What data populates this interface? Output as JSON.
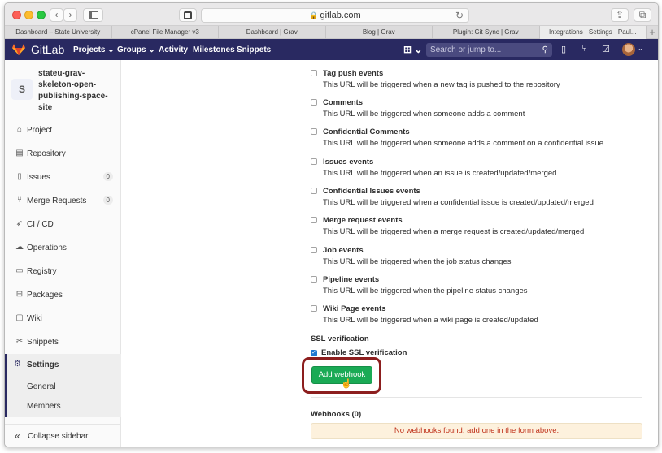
{
  "browser": {
    "url": "gitlab.com",
    "tabs": [
      {
        "label": "Dashboard – State University",
        "active": false
      },
      {
        "label": "cPanel File Manager v3",
        "active": false
      },
      {
        "label": "Dashboard | Grav",
        "active": false
      },
      {
        "label": "Blog | Grav",
        "active": false
      },
      {
        "label": "Plugin: Git Sync | Grav",
        "active": false
      },
      {
        "label": "Integrations · Settings · Paul...",
        "active": true
      }
    ],
    "new_tab": "+"
  },
  "header": {
    "brand": "GitLab",
    "menu": [
      "Projects ⌄",
      "Groups ⌄",
      "Activity",
      "Milestones",
      "Snippets"
    ],
    "search_placeholder": "Search or jump to...",
    "colors": {
      "nav_bg": "#292961",
      "accent": "#1aaa55"
    }
  },
  "sidebar": {
    "avatar_letter": "S",
    "project_name": "stateu-grav-skeleton-open-publishing-space-site",
    "items": [
      {
        "label": "Project",
        "icon": "home-icon",
        "count": null
      },
      {
        "label": "Repository",
        "icon": "doc-icon",
        "count": null
      },
      {
        "label": "Issues",
        "icon": "issues-icon",
        "count": "0"
      },
      {
        "label": "Merge Requests",
        "icon": "merge-icon",
        "count": "0"
      },
      {
        "label": "CI / CD",
        "icon": "rocket-icon",
        "count": null
      },
      {
        "label": "Operations",
        "icon": "cloud-icon",
        "count": null
      },
      {
        "label": "Registry",
        "icon": "registry-icon",
        "count": null
      },
      {
        "label": "Packages",
        "icon": "package-icon",
        "count": null
      },
      {
        "label": "Wiki",
        "icon": "book-icon",
        "count": null
      },
      {
        "label": "Snippets",
        "icon": "scissors-icon",
        "count": null
      }
    ],
    "settings": {
      "label": "Settings",
      "sub": [
        "General",
        "Members"
      ]
    },
    "collapse": "Collapse sidebar"
  },
  "main": {
    "events": [
      {
        "title": "Tag push events",
        "desc": "This URL will be triggered when a new tag is pushed to the repository"
      },
      {
        "title": "Comments",
        "desc": "This URL will be triggered when someone adds a comment"
      },
      {
        "title": "Confidential Comments",
        "desc": "This URL will be triggered when someone adds a comment on a confidential issue"
      },
      {
        "title": "Issues events",
        "desc": "This URL will be triggered when an issue is created/updated/merged"
      },
      {
        "title": "Confidential Issues events",
        "desc": "This URL will be triggered when a confidential issue is created/updated/merged"
      },
      {
        "title": "Merge request events",
        "desc": "This URL will be triggered when a merge request is created/updated/merged"
      },
      {
        "title": "Job events",
        "desc": "This URL will be triggered when the job status changes"
      },
      {
        "title": "Pipeline events",
        "desc": "This URL will be triggered when the pipeline status changes"
      },
      {
        "title": "Wiki Page events",
        "desc": "This URL will be triggered when a wiki page is created/updated"
      }
    ],
    "ssl_heading": "SSL verification",
    "ssl_label": "Enable SSL verification",
    "ssl_checked": true,
    "add_button": "Add webhook",
    "webhooks_title": "Webhooks (0)",
    "empty_message": "No webhooks found, add one in the form above."
  }
}
